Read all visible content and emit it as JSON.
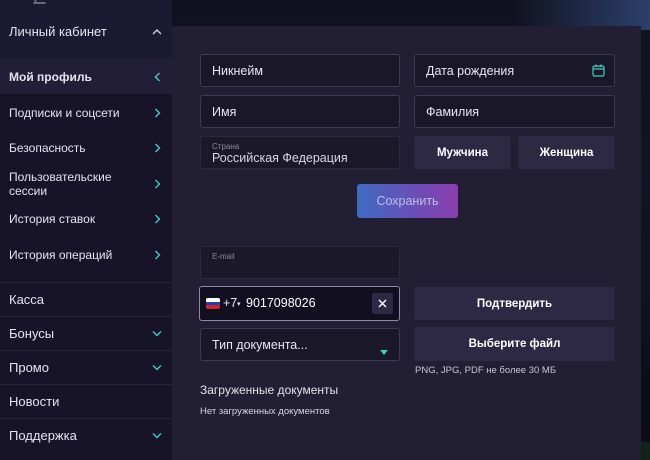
{
  "sidebar": {
    "section_title": "Личный кабинет",
    "items": [
      {
        "label": "Мой профиль",
        "active": true
      },
      {
        "label": "Подписки и соцсети"
      },
      {
        "label": "Безопасность"
      },
      {
        "label": "Пользовательские сессии"
      },
      {
        "label": "История ставок"
      },
      {
        "label": "История операций"
      }
    ],
    "main_items": [
      {
        "label": "Касса"
      },
      {
        "label": "Бонусы"
      },
      {
        "label": "Промо"
      },
      {
        "label": "Новости"
      },
      {
        "label": "Поддержка"
      }
    ]
  },
  "form": {
    "nickname": {
      "placeholder": "Никнейм"
    },
    "birthdate": {
      "placeholder": "Дата рождения"
    },
    "first_name": {
      "placeholder": "Имя"
    },
    "last_name": {
      "placeholder": "Фамилия"
    },
    "country": {
      "label": "Страна",
      "value": "Российская Федерация"
    },
    "gender": {
      "male": "Мужчина",
      "female": "Женщина"
    },
    "save_label": "Сохранить",
    "email": {
      "label": "E-mail",
      "value": ""
    },
    "phone": {
      "code": "+7",
      "number": "9017098026"
    },
    "confirm_label": "Подтвердить",
    "doc_type": {
      "placeholder": "Тип документа..."
    },
    "choose_file_label": "Выберите файл",
    "file_hint": "PNG, JPG, PDF не более 30 МБ",
    "uploaded_title": "Загруженные документы",
    "uploaded_empty": "Нет загруженных документов"
  },
  "colors": {
    "accent_teal": "#39d0c4",
    "panel_bg": "#221e34",
    "sidebar_bg": "#17142a",
    "save_gradient_start": "#3d6bbf",
    "save_gradient_end": "#8a3fae"
  },
  "icons": {
    "birthdate": "calendar-icon",
    "phone_clear": "close-icon",
    "doc_type": "caret-down-icon",
    "phone_flag": "russia-flag-icon",
    "sidebar_expand": "chevron-down-icon",
    "sidebar_go": "chevron-right-icon",
    "section_collapse": "chevron-up-icon"
  }
}
